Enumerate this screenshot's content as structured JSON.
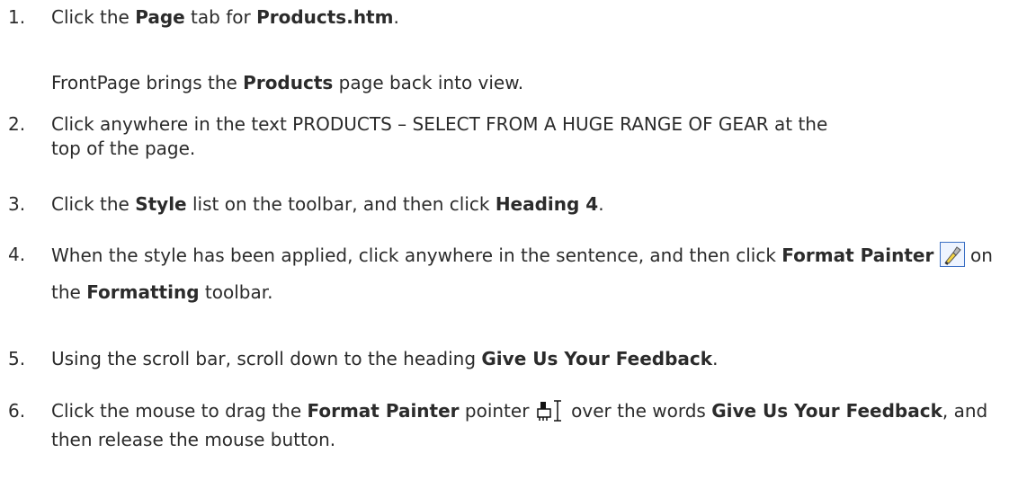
{
  "steps": [
    {
      "num": "1.",
      "a": "Click the ",
      "b1": "Page",
      "c": " tab for ",
      "b2": "Products.htm",
      "d": "."
    },
    {
      "num": "2.",
      "text": "Click anywhere in the text PRODUCTS – SELECT FROM A HUGE RANGE OF GEAR at the top of the page."
    },
    {
      "num": "3.",
      "a": "Click the ",
      "b1": "Style",
      "c": " list on the toolbar, and then click ",
      "b2": "Heading 4",
      "d": "."
    },
    {
      "num": "4.",
      "a": "When the style has been applied, click anywhere in the sentence, and then click ",
      "b1": "Format Painter",
      "c": " on the ",
      "b2": "Formatting",
      "d": " toolbar."
    },
    {
      "num": "5.",
      "a": "Using the scroll bar, scroll down to the heading ",
      "b1": "Give Us Your Feedback",
      "d": "."
    },
    {
      "num": "6.",
      "a": "Click the mouse to drag the ",
      "b1": "Format Painter",
      "c": " pointer ",
      "c2": " over the words ",
      "b2": "Give Us Your Feedback",
      "d": ", and then release the mouse button."
    }
  ],
  "note1": {
    "a": "FrontPage brings the ",
    "b": "Products",
    "c": " page back into view."
  },
  "icons": {
    "format_painter_button": "format-painter-icon",
    "format_painter_pointer": "format-painter-pointer-icon"
  }
}
